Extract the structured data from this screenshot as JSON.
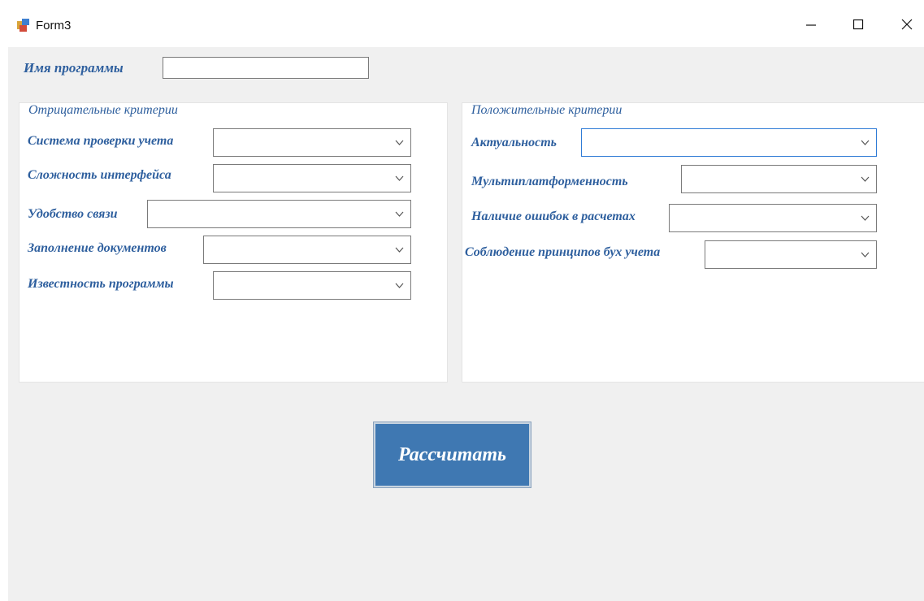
{
  "window": {
    "title": "Form3",
    "icon": "winforms-app-icon",
    "controls": [
      "minimize-icon",
      "maximize-icon",
      "close-icon"
    ]
  },
  "program_name": {
    "label": "Имя программы",
    "value": ""
  },
  "negative_group": {
    "title": "Отрицательные критерии",
    "fields": [
      {
        "label": "Система проверки учета",
        "value": ""
      },
      {
        "label": "Сложность интерфейса",
        "value": ""
      },
      {
        "label": "Удобство связи",
        "value": ""
      },
      {
        "label": "Заполнение документов",
        "value": ""
      },
      {
        "label": "Известность программы",
        "value": ""
      }
    ]
  },
  "positive_group": {
    "title": "Положительные критерии",
    "fields": [
      {
        "label": "Актуальность",
        "value": ""
      },
      {
        "label": "Мультиплатформенность",
        "value": ""
      },
      {
        "label": "Наличие ошибок в расчетах",
        "value": ""
      },
      {
        "label": "Соблюдение принципов бух учета",
        "value": ""
      }
    ]
  },
  "calculate_button": {
    "label": "Рассчитать"
  },
  "colors": {
    "label_text": "#2e5f9e",
    "button_bg": "#3f78b2",
    "client_bg": "#f0f0f0",
    "focus_border": "#2f7bd6"
  }
}
